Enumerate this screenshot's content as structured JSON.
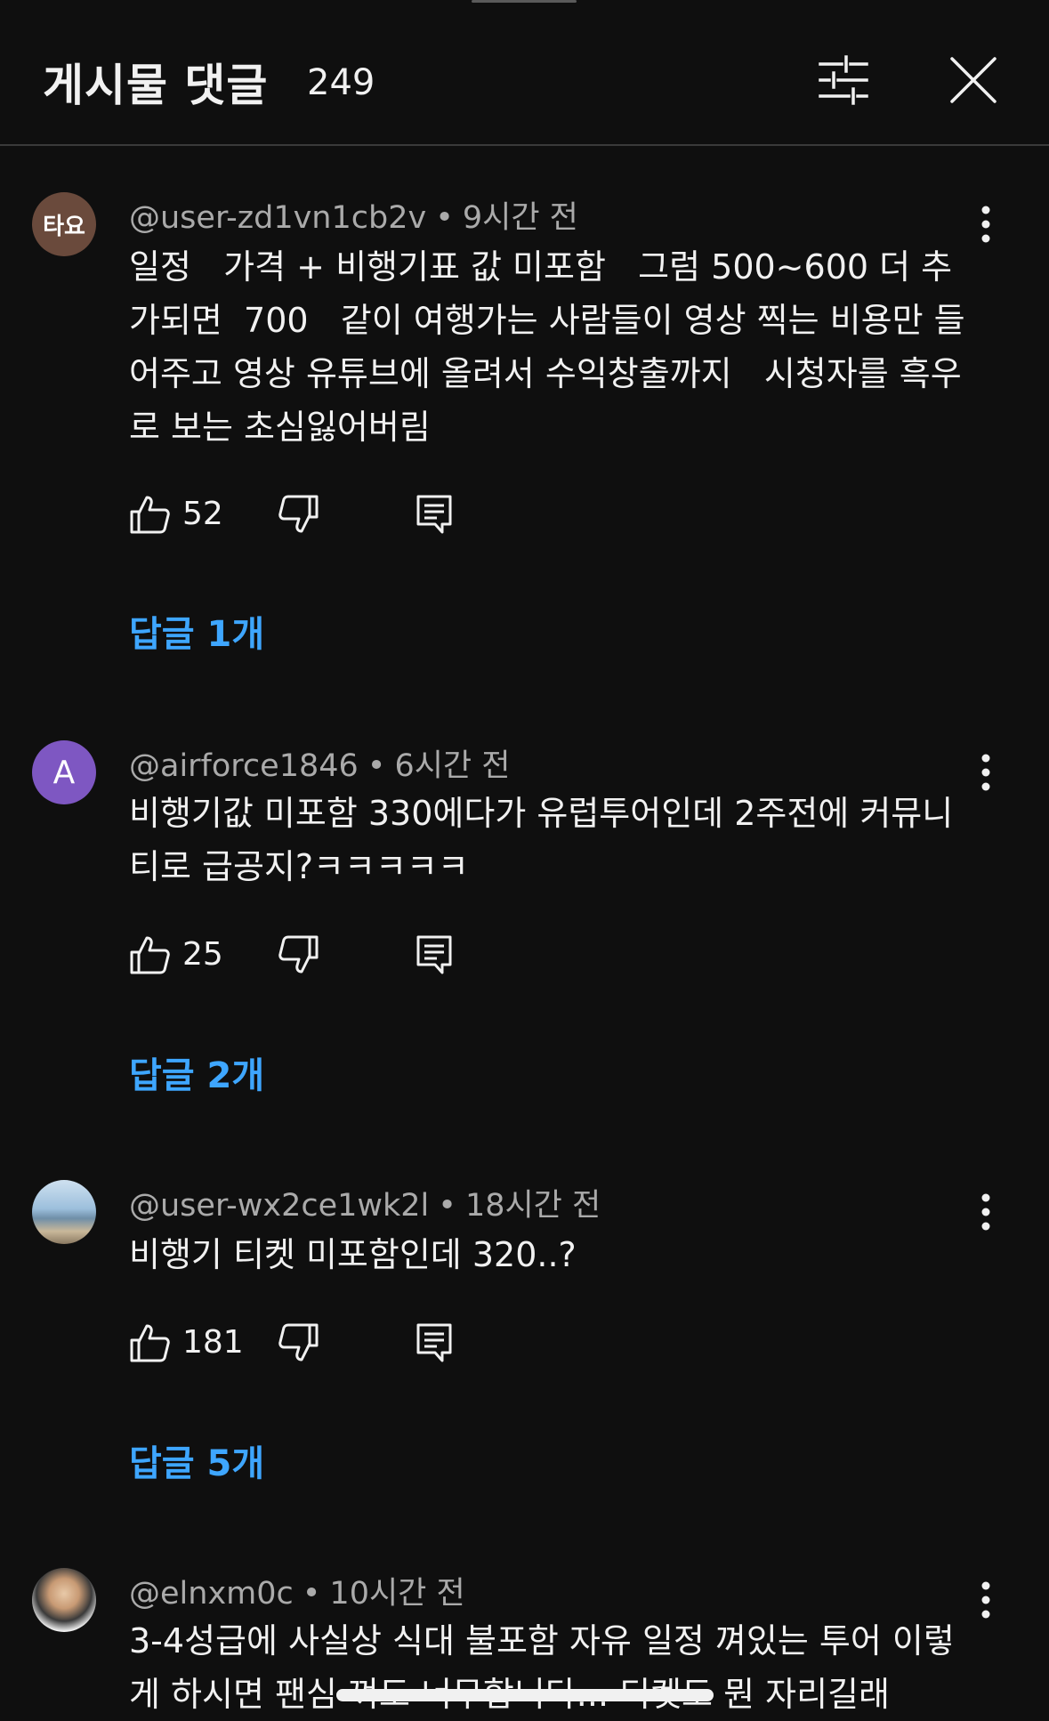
{
  "header": {
    "title": "게시물 댓글",
    "count": "249"
  },
  "comments": [
    {
      "avatar_text": "타요",
      "avatar_color": "#6a4a3c",
      "username": "@user-zd1vn1cb2v",
      "separator": "•",
      "time": "9시간 전",
      "text": "일정   가격 + 비행기표 값 미포함   그럼 500~600 더 추가되면  700   같이 여행가는 사람들이 영상 찍는 비용만 들어주고 영상 유튜브에 올려서 수익창출까지   시청자를 흑우로 보는 초심잃어버림",
      "likes": "52",
      "replies": "답글 1개"
    },
    {
      "avatar_text": "A",
      "avatar_color": "#7e57c2",
      "username": "@airforce1846",
      "separator": "•",
      "time": "6시간 전",
      "text": "비행기값 미포함 330에다가 유럽투어인데 2주전에 커뮤니티로 급공지?ㅋㅋㅋㅋㅋ",
      "likes": "25",
      "replies": "답글 2개"
    },
    {
      "avatar_text": "",
      "avatar_color": "#7fa6c9",
      "username": "@user-wx2ce1wk2l",
      "separator": "•",
      "time": "18시간 전",
      "text": "비행기 티켓 미포함인데 320..?",
      "likes": "181",
      "replies": "답글 5개"
    },
    {
      "avatar_text": "",
      "avatar_color": "#d9d2c8",
      "username": "@elnxm0c",
      "separator": "•",
      "time": "10시간 전",
      "text": "3-4성급에 사실상 식대 불포함 자유 일정 껴있는 투어 이렇게 하시면 팬심 껴도 너무합니다... 티켓도 뭔 자리길래",
      "likes": "",
      "replies": ""
    }
  ],
  "icons": {
    "filter": "sliders-icon",
    "close": "close-icon",
    "more": "more-vertical-icon",
    "like": "thumbs-up-icon",
    "dislike": "thumbs-down-icon",
    "reply": "reply-comment-icon"
  },
  "colors": {
    "background": "#0f0f0f",
    "text": "#f1f1f1",
    "meta": "#aaaaaa",
    "link": "#3ea6ff"
  }
}
